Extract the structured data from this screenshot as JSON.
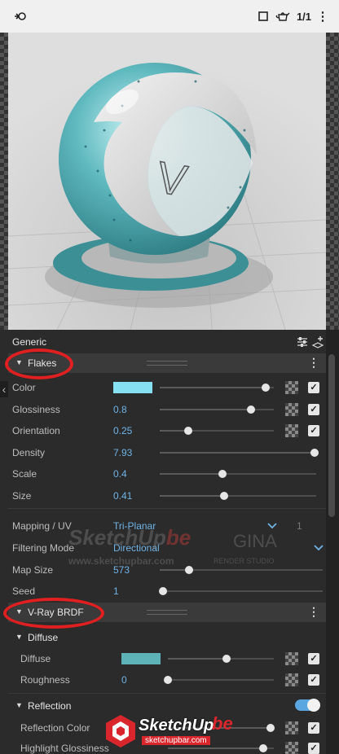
{
  "toolbar": {
    "render_icon": "render-icon",
    "aspect_icon": "square-icon",
    "teapot_icon": "teapot-icon",
    "ratio_label": "1/1",
    "more_icon": "vertical-dots-icon"
  },
  "panel": {
    "header_label": "Generic",
    "header_icons": [
      "sliders-icon",
      "add-layer-icon"
    ]
  },
  "flakes": {
    "title": "Flakes",
    "rows": [
      {
        "label": "Color",
        "value": "",
        "color": "#86e2f3",
        "slider": 0.93
      },
      {
        "label": "Glossiness",
        "value": "0.8",
        "slider": 0.8
      },
      {
        "label": "Orientation",
        "value": "0.25",
        "slider": 0.25
      },
      {
        "label": "Density",
        "value": "7.93",
        "slider": 0.99
      },
      {
        "label": "Scale",
        "value": "0.4",
        "slider": 0.4
      },
      {
        "label": "Size",
        "value": "0.41",
        "slider": 0.41
      }
    ],
    "mapping": {
      "label": "Mapping / UV",
      "value": "Tri-Planar",
      "channel": "1"
    },
    "filtering": {
      "label": "Filtering Mode",
      "value": "Directional"
    },
    "map_size": {
      "label": "Map Size",
      "value": "573",
      "slider": 0.18
    },
    "seed": {
      "label": "Seed",
      "value": "1",
      "slider": 0.0
    }
  },
  "brdf": {
    "title": "V-Ray BRDF",
    "diffuse": {
      "title": "Diffuse",
      "rows": [
        {
          "label": "Diffuse",
          "value": "",
          "color": "#5db3b7",
          "slider": 0.55
        },
        {
          "label": "Roughness",
          "value": "0",
          "slider": 0.0
        }
      ]
    },
    "reflection": {
      "title": "Reflection",
      "toggle": true,
      "rows": [
        {
          "label": "Reflection Color",
          "value": "",
          "slider": 0.97
        },
        {
          "label": "Highlight Glossiness",
          "value": "",
          "slider": 0.9
        }
      ]
    }
  },
  "watermarks": {
    "brand": "SketchUp",
    "brand_suffix": "be",
    "url": "www.sketchupbar.com",
    "gina": "GINA",
    "gina_sub": "RENDER STUDIO",
    "bottom_url": "sketchupbar.com"
  },
  "colors": {
    "accent": "#6fb3e6",
    "flake_color": "#86e2f3",
    "diffuse_color": "#5db3b7",
    "highlight": "#e02020"
  }
}
